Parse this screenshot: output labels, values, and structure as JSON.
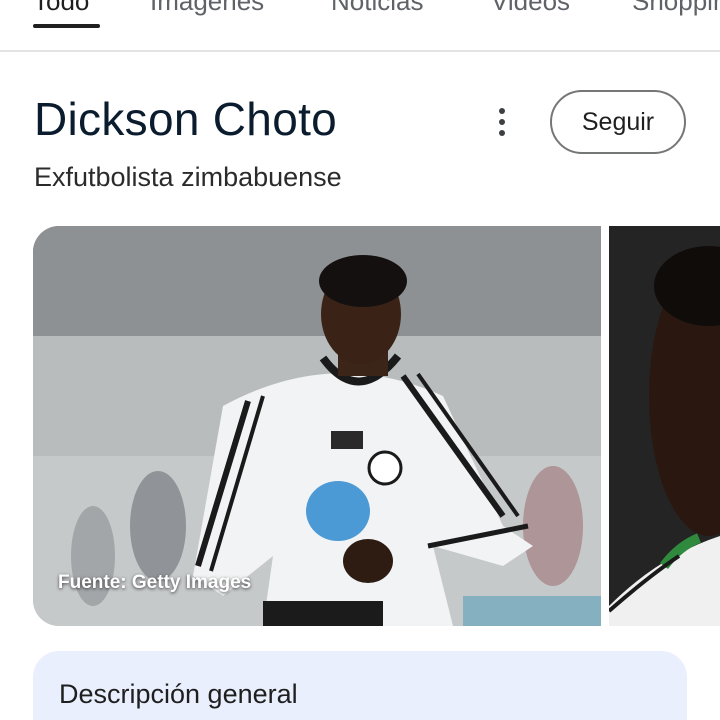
{
  "tabs": [
    {
      "label": "Todo",
      "active": true
    },
    {
      "label": "Imágenes"
    },
    {
      "label": "Noticias"
    },
    {
      "label": "Videos"
    },
    {
      "label": "Shopping"
    }
  ],
  "entity": {
    "title": "Dickson Choto",
    "subtitle": "Exfutbolista zimbabuense",
    "follow_label": "Seguir",
    "more_icon": "more-vert-icon"
  },
  "images": {
    "main_caption": "Fuente: Getty Images",
    "main_alt_icon": "player-photo",
    "side_alt_icon": "player-portrait"
  },
  "overview": {
    "title": "Descripción general"
  },
  "colors": {
    "accent_bg": "#e9effd",
    "title": "#0b1c2e"
  }
}
